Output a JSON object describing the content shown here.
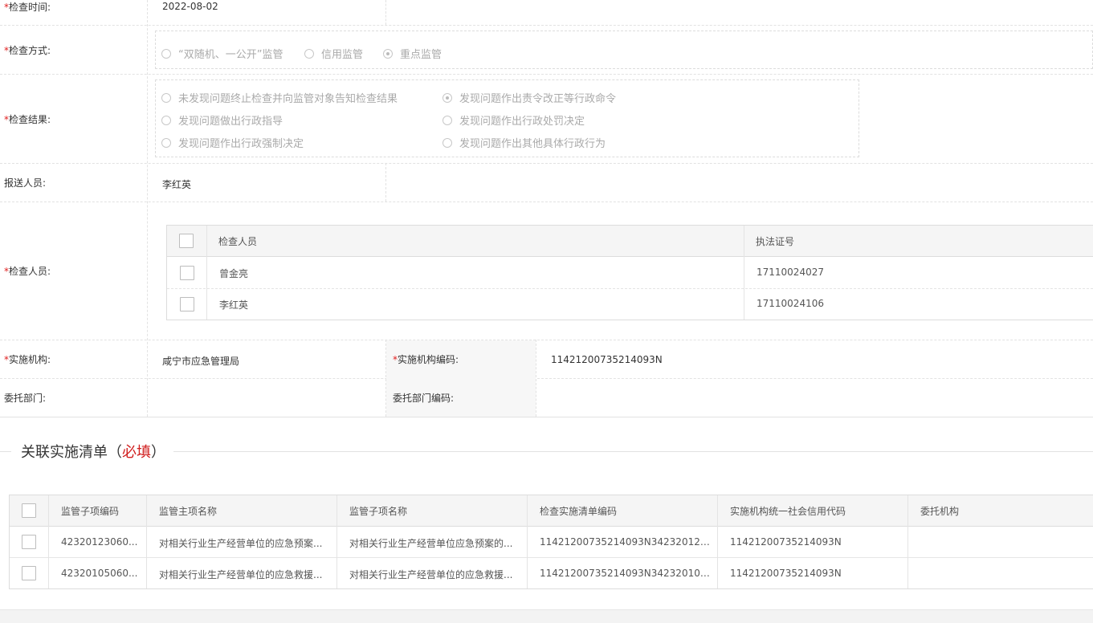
{
  "form": {
    "check_time": {
      "label": "检查时间:",
      "value": "2022-08-02"
    },
    "check_method": {
      "label": "检查方式:",
      "options": [
        "“双随机、一公开”监管",
        "信用监管",
        "重点监管"
      ],
      "selected": "重点监管"
    },
    "check_result": {
      "label": "检查结果:",
      "options": [
        "未发现问题终止检查并向监管对象告知检查结果",
        "发现问题作出责令改正等行政命令",
        "发现问题做出行政指导",
        "发现问题作出行政处罚决定",
        "发现问题作出行政强制决定",
        "发现问题作出其他具体行政行为"
      ],
      "selected": "发现问题作出责令改正等行政命令"
    },
    "reporter": {
      "label": "报送人员:",
      "value": "李红英"
    },
    "inspectors": {
      "label": "检查人员:",
      "headers": [
        "检查人员",
        "执法证号"
      ],
      "rows": [
        {
          "name": "曾金亮",
          "cert": "17110024027"
        },
        {
          "name": "李红英",
          "cert": "17110024106"
        }
      ]
    },
    "agency": {
      "label": "实施机构:",
      "value": "咸宁市应急管理局"
    },
    "agency_code": {
      "label": "实施机构编码:",
      "value": "11421200735214093N"
    },
    "entrusted_dept": {
      "label": "委托部门:",
      "value": ""
    },
    "entrusted_dept_code": {
      "label": "委托部门编码:",
      "value": ""
    },
    "required_mark": "*"
  },
  "section": {
    "title": "关联实施清单（",
    "must": "必填",
    "close": "）"
  },
  "list_table": {
    "headers": [
      "监管子项编码",
      "监管主项名称",
      "监管子项名称",
      "检查实施清单编码",
      "实施机构统一社会信用代码",
      "委托机构"
    ],
    "rows": [
      [
        "42320123060...",
        "对相关行业生产经营单位的应急预案...",
        "对相关行业生产经营单位应急预案的...",
        "11421200735214093N3423201230...",
        "11421200735214093N",
        ""
      ],
      [
        "42320105060...",
        "对相关行业生产经营单位的应急救援...",
        "对相关行业生产经营单位的应急救援...",
        "11421200735214093N3423201050...",
        "11421200735214093N",
        ""
      ]
    ]
  },
  "colors": {
    "required": "#e02020",
    "label_bg": "#f7f7f7",
    "border": "#dcdcdc"
  }
}
